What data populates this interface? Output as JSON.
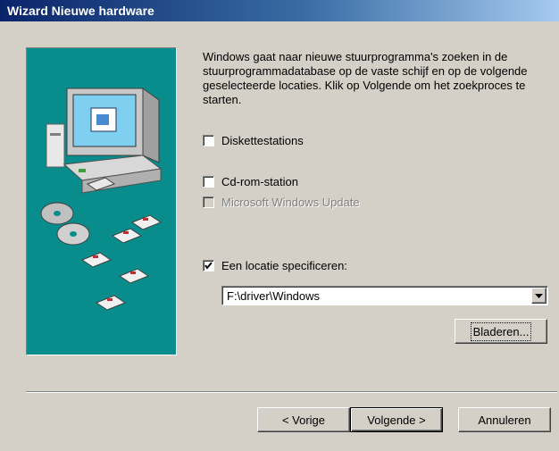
{
  "window": {
    "title": "Wizard Nieuwe hardware"
  },
  "description": "Windows gaat naar nieuwe stuurprogramma's zoeken in de stuurprogrammadatabase op de vaste schijf en op de volgende geselecteerde locaties. Klik op Volgende om het zoekproces te starten.",
  "options": [
    {
      "label": "Diskettestations",
      "checked": false,
      "enabled": true
    },
    {
      "label": "Cd-rom-station",
      "checked": false,
      "enabled": true
    },
    {
      "label": "Microsoft Windows Update",
      "checked": false,
      "enabled": false
    },
    {
      "label": "Een locatie specificeren:",
      "checked": true,
      "enabled": true
    }
  ],
  "location": {
    "value": "F:\\driver\\Windows"
  },
  "buttons": {
    "browse": "Bladeren...",
    "back": "< Vorige",
    "next": "Volgende >",
    "cancel": "Annuleren"
  },
  "colors": {
    "title_start": "#0a246a",
    "title_end": "#a6caf0",
    "art_bg": "#088c8c",
    "face": "#d4d0c8"
  },
  "icons": {
    "illustration": "computer-with-discs-illustration"
  }
}
